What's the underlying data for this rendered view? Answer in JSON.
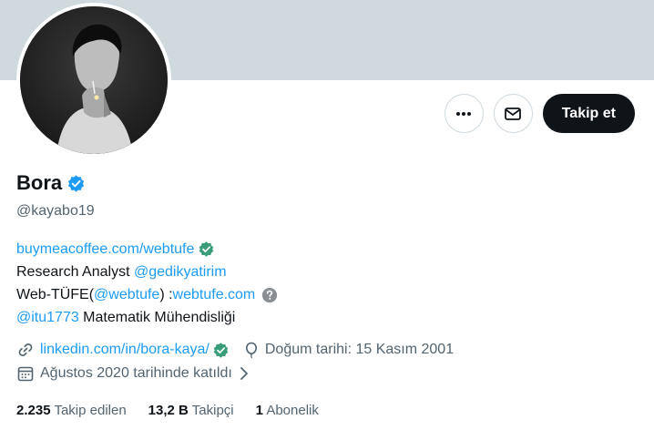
{
  "profile": {
    "name": "Bora",
    "handle": "@kayabo19",
    "avatar_alt": "profile photo"
  },
  "actions": {
    "more_icon": "more-horizontal-icon",
    "message_icon": "envelope-icon",
    "follow_label": "Takip et"
  },
  "bio": {
    "line1_link": "buymeacoffee.com/webtufe",
    "line2_text": "Research Analyst ",
    "line2_mention": "@gedikyatirim",
    "line3_prefix": "Web-TÜFE(",
    "line3_mention": "@webtufe",
    "line3_mid": ") :",
    "line3_link": "webtufe.com",
    "line4_mention": "@itu1773",
    "line4_text": " Matematik Mühendisliği"
  },
  "meta": {
    "website": "linkedin.com/in/bora-kaya/",
    "birthday": "Doğum tarihi: 15 Kasım 2001",
    "joined": "Ağustos 2020 tarihinde katıldı"
  },
  "stats": {
    "following_count": "2.235",
    "following_label": "Takip edilen",
    "followers_count": "13,2 B",
    "followers_label": "Takipçi",
    "subscribers_count": "1",
    "subscribers_label": "Abonelik"
  },
  "colors": {
    "accent": "#1d9bf0",
    "verified_green": "#3a9d7a",
    "banner": "#cfd9de",
    "text_secondary": "#536471"
  }
}
